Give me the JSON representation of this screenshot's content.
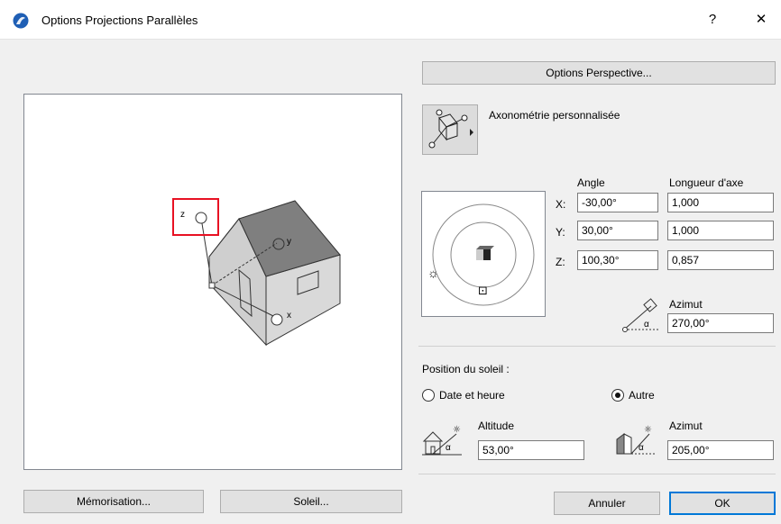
{
  "window": {
    "title": "Options Projections Parallèles",
    "help_glyph": "?",
    "close_glyph": "✕"
  },
  "buttons": {
    "perspective": "Options Perspective...",
    "memorisation": "Mémorisation...",
    "soleil": "Soleil...",
    "cancel": "Annuler",
    "ok": "OK"
  },
  "projection": {
    "type_label": "Axonométrie personnalisée"
  },
  "axes": {
    "angle_header": "Angle",
    "length_header": "Longueur d'axe",
    "rows": [
      {
        "axis": "X:",
        "angle": "-30,00°",
        "length": "1,000"
      },
      {
        "axis": "Y:",
        "angle": "30,00°",
        "length": "1,000"
      },
      {
        "axis": "Z:",
        "angle": "100,30°",
        "length": "0,857"
      }
    ]
  },
  "view_azimuth": {
    "label": "Azimut",
    "value": "270,00°"
  },
  "sun": {
    "section_label": "Position du soleil :",
    "radio_date": "Date et heure",
    "radio_other": "Autre",
    "selected": "other",
    "altitude_label": "Altitude",
    "altitude_value": "53,00°",
    "azimuth_label": "Azimut",
    "azimuth_value": "205,00°"
  },
  "preview": {
    "axis_z": "z",
    "axis_y": "y",
    "axis_x": "x"
  },
  "colors": {
    "highlight": "#e81123",
    "focus": "#0078d7",
    "roof": "#7f7f7f",
    "wall": "#cfcfcf"
  },
  "icons": {
    "app": "archicad-icon",
    "projection_type": "axonometry-icon",
    "sun": "sun-icon",
    "camera": "camera-icon"
  }
}
